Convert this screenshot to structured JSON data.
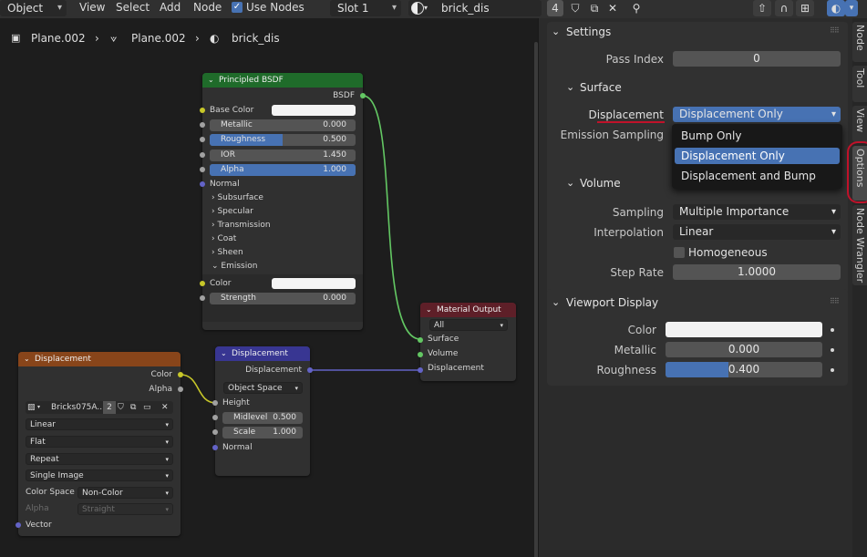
{
  "header": {
    "mode": "Object",
    "menus": [
      "View",
      "Select",
      "Add",
      "Node"
    ],
    "use_nodes_label": "Use Nodes",
    "slot": "Slot 1",
    "material_name": "brick_dis",
    "user_count": "4"
  },
  "breadcrumb": {
    "object": "Plane.002",
    "mesh": "Plane.002",
    "material": "brick_dis"
  },
  "nodes": {
    "principled": {
      "title": "Principled BSDF",
      "output": "BSDF",
      "base_color": "Base Color",
      "metallic_label": "Metallic",
      "metallic_value": "0.000",
      "roughness_label": "Roughness",
      "roughness_value": "0.500",
      "roughness_fill": 0.5,
      "ior_label": "IOR",
      "ior_value": "1.450",
      "alpha_label": "Alpha",
      "alpha_value": "1.000",
      "alpha_fill": 1.0,
      "normal": "Normal",
      "subpanels": [
        "Subsurface",
        "Specular",
        "Transmission",
        "Coat",
        "Sheen",
        "Emission"
      ],
      "emission_color": "Color",
      "strength_label": "Strength",
      "strength_value": "0.000"
    },
    "material_output": {
      "title": "Material Output",
      "target": "All",
      "inputs": [
        "Surface",
        "Volume",
        "Displacement"
      ]
    },
    "displacement": {
      "title": "Displacement",
      "output": "Displacement",
      "space": "Object Space",
      "height": "Height",
      "midlevel_label": "Midlevel",
      "midlevel_value": "0.500",
      "scale_label": "Scale",
      "scale_value": "1.000",
      "normal": "Normal"
    },
    "image_texture": {
      "title": "Displacement",
      "out_color": "Color",
      "out_alpha": "Alpha",
      "image_name": "Bricks075A...",
      "image_users": "2",
      "interpolation": "Linear",
      "projection": "Flat",
      "extension": "Repeat",
      "source": "Single Image",
      "color_space_label": "Color Space",
      "color_space": "Non-Color",
      "alpha_label": "Alpha",
      "alpha_mode": "Straight",
      "vector": "Vector"
    }
  },
  "props": {
    "settings": {
      "title": "Settings",
      "pass_index_label": "Pass Index",
      "pass_index": "0"
    },
    "surface": {
      "title": "Surface",
      "displacement_label": "Displacement",
      "displacement_value": "Displacement Only",
      "emission_label": "Emission Sampling"
    },
    "dropdown_options": [
      "Bump Only",
      "Displacement Only",
      "Displacement and Bump"
    ],
    "volume": {
      "title": "Volume",
      "sampling_label": "Sampling",
      "sampling": "Multiple Importance",
      "interpolation_label": "Interpolation",
      "interpolation": "Linear",
      "homogeneous_label": "Homogeneous",
      "step_rate_label": "Step Rate",
      "step_rate": "1.0000"
    },
    "viewport": {
      "title": "Viewport Display",
      "color_label": "Color",
      "metallic_label": "Metallic",
      "metallic": "0.000",
      "roughness_label": "Roughness",
      "roughness": "0.400",
      "roughness_fill": 0.4
    }
  },
  "tabs": [
    "Node",
    "Tool",
    "View",
    "Options",
    "Node Wrangler"
  ],
  "colors": {
    "accent": "#4772b3",
    "principled_header": "#1f6b2a",
    "output_header": "#5e1f28",
    "vector_header": "#383692",
    "texture_header": "#88451a",
    "annotation": "#c0122a"
  }
}
